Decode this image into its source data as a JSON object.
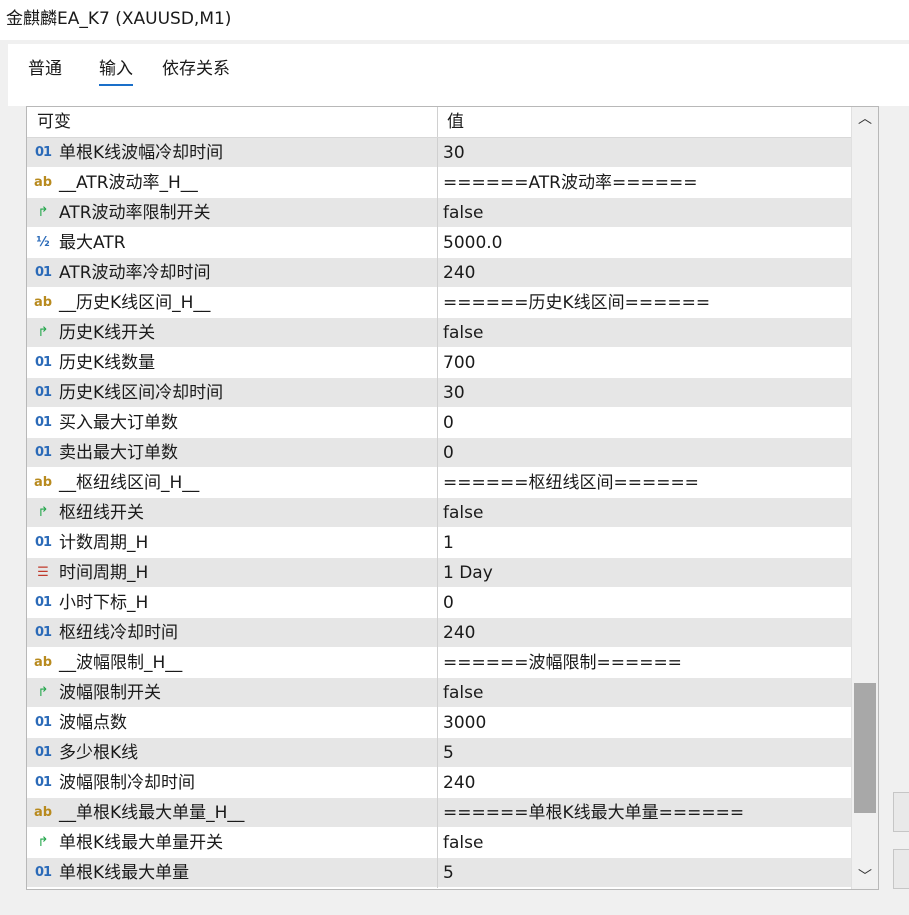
{
  "window": {
    "title": "金麒麟EA_K7 (XAUUSD,M1)"
  },
  "tabs": [
    {
      "label": "普通",
      "active": false
    },
    {
      "label": "输入",
      "active": true
    },
    {
      "label": "依存关系",
      "active": false
    }
  ],
  "table": {
    "headers": {
      "variable": "可变",
      "value": "值"
    },
    "rows": [
      {
        "type": "int",
        "icon": "01",
        "name": "单根K线波幅冷却时间",
        "value": "30"
      },
      {
        "type": "string",
        "icon": "ab",
        "name": "__ATR波动率_H__",
        "value": "======ATR波动率======"
      },
      {
        "type": "bool",
        "icon": "↱",
        "name": "ATR波动率限制开关",
        "value": "false"
      },
      {
        "type": "double",
        "icon": "½",
        "name": "最大ATR",
        "value": "5000.0"
      },
      {
        "type": "int",
        "icon": "01",
        "name": "ATR波动率冷却时间",
        "value": "240"
      },
      {
        "type": "string",
        "icon": "ab",
        "name": "__历史K线区间_H__",
        "value": "======历史K线区间======"
      },
      {
        "type": "bool",
        "icon": "↱",
        "name": "历史K线开关",
        "value": "false"
      },
      {
        "type": "int",
        "icon": "01",
        "name": "历史K线数量",
        "value": "700"
      },
      {
        "type": "int",
        "icon": "01",
        "name": "历史K线区间冷却时间",
        "value": "30"
      },
      {
        "type": "int",
        "icon": "01",
        "name": "买入最大订单数",
        "value": "0"
      },
      {
        "type": "int",
        "icon": "01",
        "name": "卖出最大订单数",
        "value": "0"
      },
      {
        "type": "string",
        "icon": "ab",
        "name": "__枢纽线区间_H__",
        "value": "======枢纽线区间======"
      },
      {
        "type": "bool",
        "icon": "↱",
        "name": "枢纽线开关",
        "value": "false"
      },
      {
        "type": "int",
        "icon": "01",
        "name": "计数周期_H",
        "value": "1"
      },
      {
        "type": "enum",
        "icon": "☰",
        "name": "时间周期_H",
        "value": "1 Day"
      },
      {
        "type": "int",
        "icon": "01",
        "name": "小时下标_H",
        "value": "0"
      },
      {
        "type": "int",
        "icon": "01",
        "name": "枢纽线冷却时间",
        "value": "240"
      },
      {
        "type": "string",
        "icon": "ab",
        "name": "__波幅限制_H__",
        "value": "======波幅限制======"
      },
      {
        "type": "bool",
        "icon": "↱",
        "name": "波幅限制开关",
        "value": "false"
      },
      {
        "type": "int",
        "icon": "01",
        "name": "波幅点数",
        "value": "3000"
      },
      {
        "type": "int",
        "icon": "01",
        "name": "多少根K线",
        "value": "5"
      },
      {
        "type": "int",
        "icon": "01",
        "name": "波幅限制冷却时间",
        "value": "240"
      },
      {
        "type": "string",
        "icon": "ab",
        "name": "__单根K线最大单量_H__",
        "value": "======单根K线最大单量======"
      },
      {
        "type": "bool",
        "icon": "↱",
        "name": "单根K线最大单量开关",
        "value": "false"
      },
      {
        "type": "int",
        "icon": "01",
        "name": "单根K线最大单量",
        "value": "5"
      }
    ]
  },
  "scrollbar": {
    "up": "︿",
    "down": "﹀"
  }
}
